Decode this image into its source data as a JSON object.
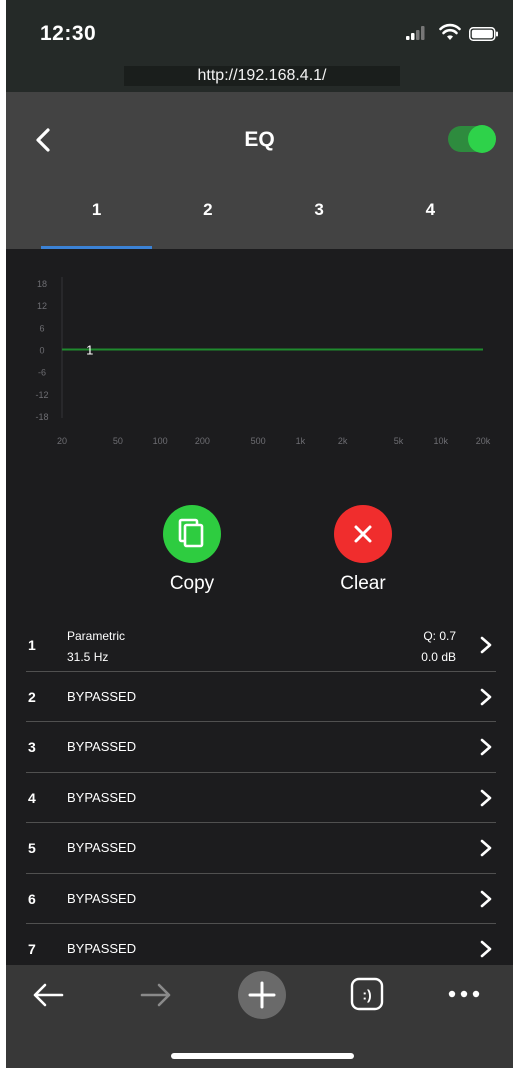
{
  "status_bar": {
    "time": "12:30"
  },
  "browser": {
    "url": "http://192.168.4.1/"
  },
  "header": {
    "title": "EQ",
    "enabled": true
  },
  "tabs": [
    {
      "label": "1",
      "active": true
    },
    {
      "label": "2",
      "active": false
    },
    {
      "label": "3",
      "active": false
    },
    {
      "label": "4",
      "active": false
    }
  ],
  "chart_data": {
    "type": "line",
    "y_ticks": [
      "18",
      "12",
      "6",
      "0",
      "-6",
      "-12",
      "-18"
    ],
    "x_ticks": [
      "20",
      "50",
      "100",
      "200",
      "500",
      "1k",
      "2k",
      "5k",
      "10k",
      "20k"
    ],
    "ylim": [
      -18,
      18
    ],
    "xlim": [
      20,
      20000
    ],
    "x_scale": "log",
    "series": [
      {
        "x": [
          20,
          20000
        ],
        "values": [
          0,
          0
        ],
        "color": "#1f8a2e"
      }
    ],
    "markers": [
      {
        "label": "1",
        "x": 31.5,
        "y": 0
      }
    ]
  },
  "actions": {
    "copy_label": "Copy",
    "clear_label": "Clear",
    "copy_color": "#2ecc40",
    "clear_color": "#f02d2d"
  },
  "filters": [
    {
      "num": "1",
      "type": "Parametric",
      "freq": "31.5 Hz",
      "q": "Q: 0.7",
      "gain": "0.0 dB"
    },
    {
      "num": "2",
      "label": "BYPASSED"
    },
    {
      "num": "3",
      "label": "BYPASSED"
    },
    {
      "num": "4",
      "label": "BYPASSED"
    },
    {
      "num": "5",
      "label": "BYPASSED"
    },
    {
      "num": "6",
      "label": "BYPASSED"
    },
    {
      "num": "7",
      "label": "BYPASSED"
    }
  ],
  "toolbar": {
    "icons": [
      "back-arrow-icon",
      "forward-arrow-icon",
      "plus-icon",
      "tabs-icon",
      "more-icon"
    ],
    "tabs_glyph": ":)"
  }
}
